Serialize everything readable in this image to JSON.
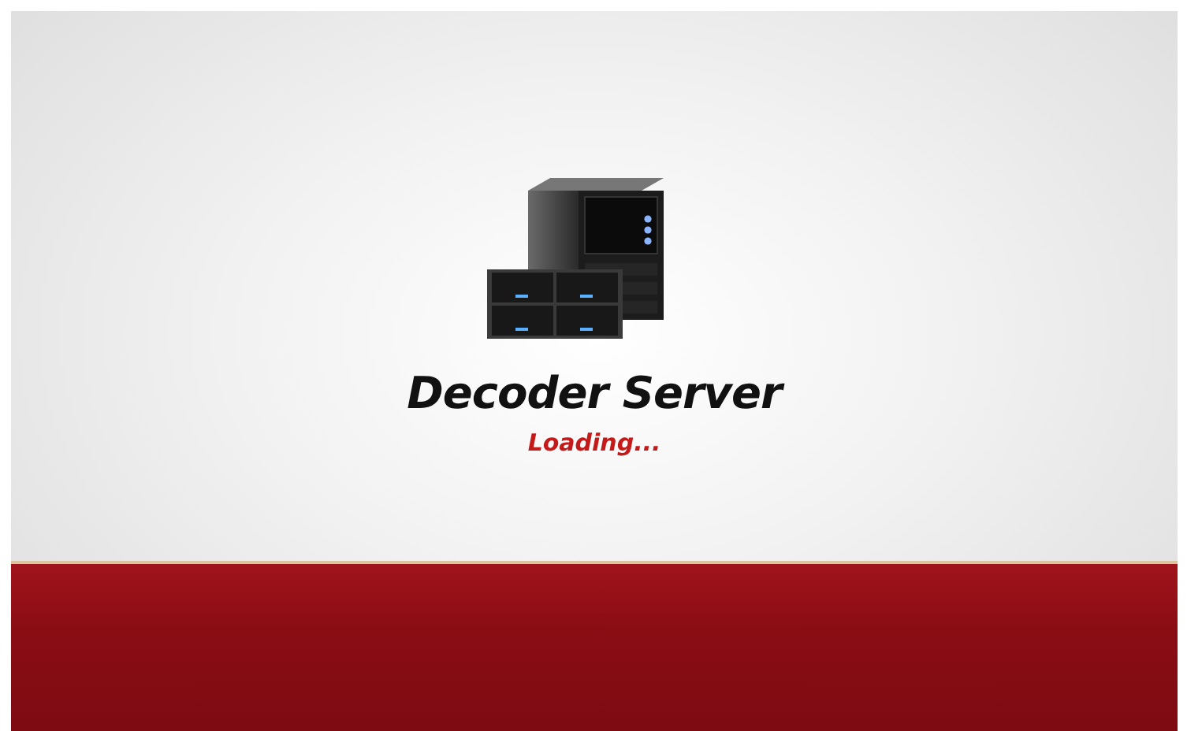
{
  "splash": {
    "title": "Decoder Server",
    "status": "Loading..."
  }
}
